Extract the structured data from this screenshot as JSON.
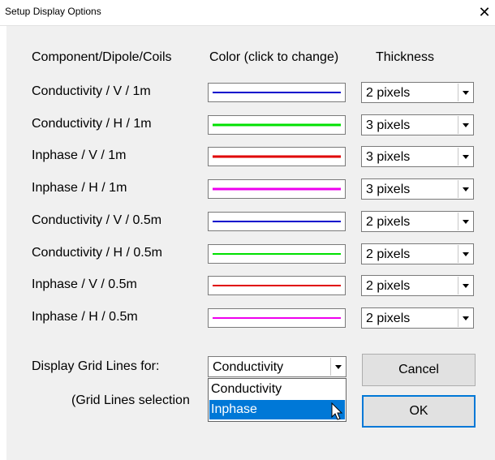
{
  "window": {
    "title": "Setup Display Options",
    "close_glyph": "✕"
  },
  "headers": {
    "component": "Component/Dipole/Coils",
    "color": "Color (click to change)",
    "thickness": "Thickness"
  },
  "rows": [
    {
      "label": "Conductivity / V / 1m",
      "color": "#0000cc",
      "thickness": "2 pixels"
    },
    {
      "label": "Conductivity / H / 1m",
      "color": "#00e000",
      "thickness": "3 pixels"
    },
    {
      "label": "Inphase / V / 1m",
      "color": "#e00000",
      "thickness": "3 pixels"
    },
    {
      "label": "Inphase / H / 1m",
      "color": "#ee00ee",
      "thickness": "3 pixels"
    },
    {
      "label": "Conductivity / V / 0.5m",
      "color": "#0000cc",
      "thickness": "2 pixels"
    },
    {
      "label": "Conductivity / H / 0.5m",
      "color": "#00e000",
      "thickness": "2 pixels"
    },
    {
      "label": "Inphase / V / 0.5m",
      "color": "#e00000",
      "thickness": "2 pixels"
    },
    {
      "label": "Inphase / H / 0.5m",
      "color": "#ee00ee",
      "thickness": "2 pixels"
    }
  ],
  "grid": {
    "label": "Display Grid Lines for:",
    "selected": "Conductivity",
    "options": [
      "Conductivity",
      "Inphase"
    ],
    "highlighted_option": "Inphase",
    "note": "(Grid Lines selection"
  },
  "buttons": {
    "cancel": "Cancel",
    "ok": "OK"
  },
  "colors": {
    "selection": "#0078d7",
    "face": "#f0f0f0"
  }
}
